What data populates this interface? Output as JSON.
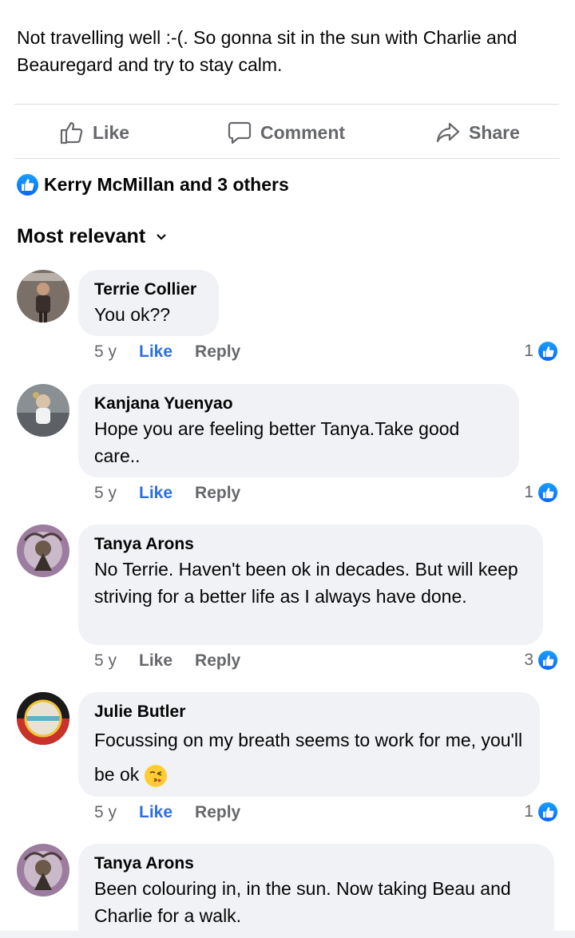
{
  "post": {
    "text": "Not travelling well :-(.  So gonna sit in the sun with Charlie and Beauregard and try to stay calm."
  },
  "actions": {
    "like_label": "Like",
    "comment_label": "Comment",
    "share_label": "Share"
  },
  "reactions": {
    "summary": "Kerry McMillan and 3 others",
    "icon": "like-icon"
  },
  "sort": {
    "label": "Most relevant",
    "icon": "chevron-down-icon"
  },
  "comments": [
    {
      "author": "Terrie Collier",
      "text": "You ok??",
      "time": "5 y",
      "like_label": "Like",
      "reply_label": "Reply",
      "reaction_count": "1",
      "liked_by_viewer": true
    },
    {
      "author": "Kanjana Yuenyao",
      "text": "Hope you are feeling better Tanya.Take good care..",
      "time": "5 y",
      "like_label": "Like",
      "reply_label": "Reply",
      "reaction_count": "1",
      "liked_by_viewer": true
    },
    {
      "author": "Tanya Arons",
      "text": "No Terrie. Haven't been ok in decades.  But will keep striving for a better life as I always have done.",
      "time": "5 y",
      "like_label": "Like",
      "reply_label": "Reply",
      "reaction_count": "3",
      "liked_by_viewer": false
    },
    {
      "author": "Julie Butler",
      "text": "Focussing on my breath seems to work for me, you'll be ok",
      "emoji": "kissing-face-emoji",
      "time": "5 y",
      "like_label": "Like",
      "reply_label": "Reply",
      "reaction_count": "1",
      "liked_by_viewer": true
    },
    {
      "author": "Tanya Arons",
      "text": "Been colouring in, in the sun.  Now taking Beau and Charlie for a walk."
    }
  ],
  "colors": {
    "like_blue": "#0866ff",
    "link_blue": "#2d6fe0",
    "secondary_text": "#65676b",
    "bubble_bg": "#f0f2f5"
  }
}
